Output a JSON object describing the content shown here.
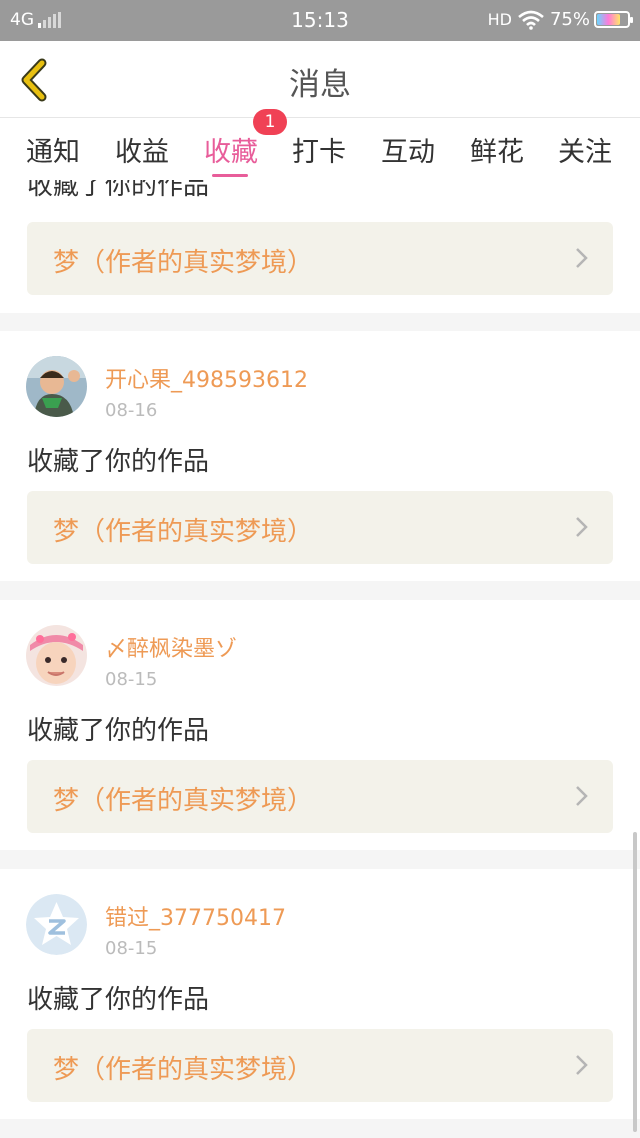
{
  "status_bar": {
    "network": "4G",
    "time": "15:13",
    "hd": "HD",
    "battery": "75%",
    "battery_level": 0.75
  },
  "header": {
    "title": "消息",
    "back_icon": "chevron-left-icon",
    "accent": "#e8c010"
  },
  "tabs": {
    "items": [
      {
        "label": "通知"
      },
      {
        "label": "收益"
      },
      {
        "label": "收藏"
      },
      {
        "label": "打卡"
      },
      {
        "label": "互动"
      },
      {
        "label": "鲜花"
      },
      {
        "label": "关注"
      }
    ],
    "active_index": 2,
    "badge": "1",
    "active_color": "#e85d9a",
    "badge_color": "#f04155"
  },
  "feed": {
    "partial": {
      "action": "收藏了你的作品",
      "work_title": "梦（作者的真实梦境）"
    },
    "items": [
      {
        "username": "开心果_498593612",
        "date": "08-16",
        "action": "收藏了你的作品",
        "work_title": "梦（作者的真实梦境）",
        "avatar": "child-photo-avatar"
      },
      {
        "username": "〆醉枫染墨ゾ",
        "date": "08-15",
        "action": "收藏了你的作品",
        "work_title": "梦（作者的真实梦境）",
        "avatar": "baby-photo-avatar"
      },
      {
        "username": "错过_377750417",
        "date": "08-15",
        "action": "收藏了你的作品",
        "work_title": "梦（作者的真实梦境）",
        "avatar": "default-star-avatar"
      }
    ],
    "name_color": "#ee9a55"
  }
}
